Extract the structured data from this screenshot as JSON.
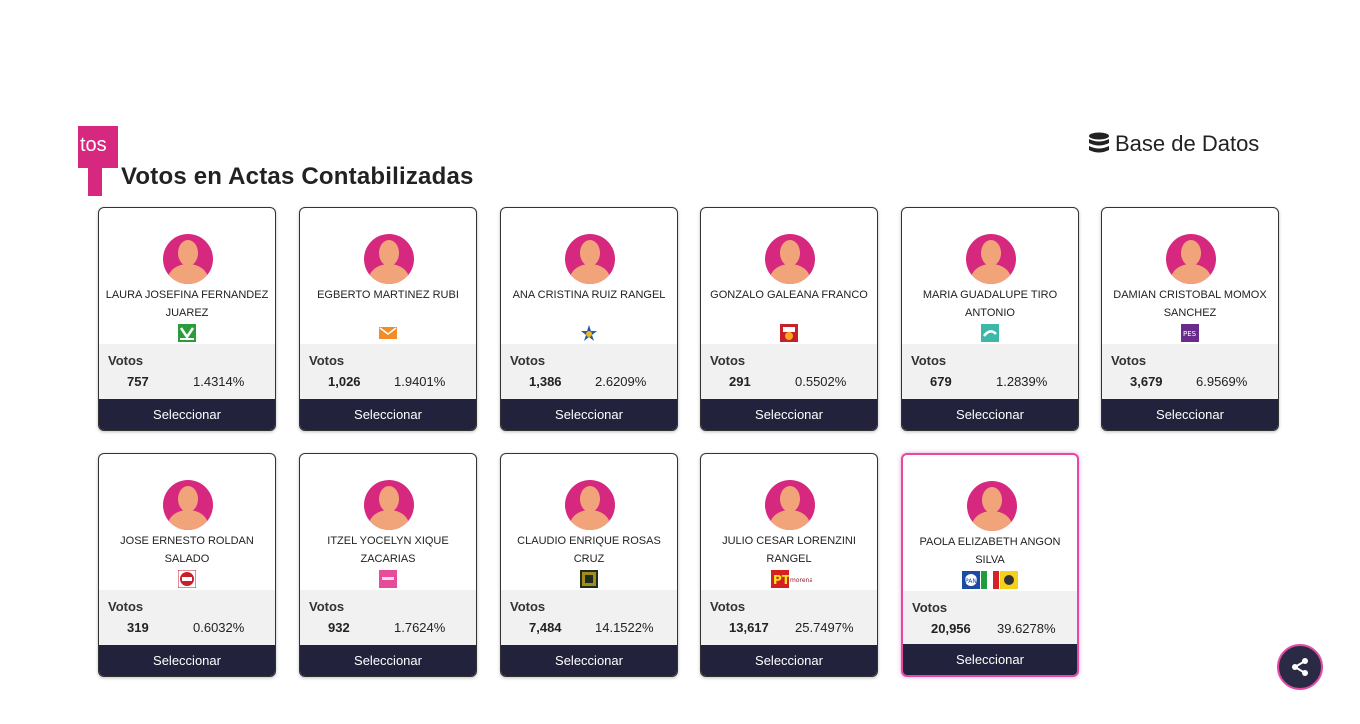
{
  "header": {
    "tab_fragment": "tos",
    "section_title": "Votos en Actas Contabilizadas",
    "database_link": "Base de Datos",
    "database_icon": "database-icon"
  },
  "colors": {
    "accent": "#d6287f",
    "button_bg": "#22223c",
    "selected_border": "#e24aa3"
  },
  "candidates": [
    {
      "name": "LAURA JOSEFINA FERNANDEZ JUAREZ",
      "party_icons": [
        "pvem-logo"
      ],
      "votes_label": "Votos",
      "votes": "757",
      "percent": "1.4314%",
      "button": "Seleccionar"
    },
    {
      "name": "EGBERTO MARTINEZ RUBI",
      "party_icons": [
        "mc-logo"
      ],
      "votes_label": "Votos",
      "votes": "1,026",
      "percent": "1.9401%",
      "button": "Seleccionar"
    },
    {
      "name": "ANA CRISTINA RUIZ RANGEL",
      "party_icons": [
        "independent-logo"
      ],
      "votes_label": "Votos",
      "votes": "1,386",
      "percent": "2.6209%",
      "button": "Seleccionar"
    },
    {
      "name": "GONZALO GALEANA FRANCO",
      "party_icons": [
        "psi-logo"
      ],
      "votes_label": "Votos",
      "votes": "291",
      "percent": "0.5502%",
      "button": "Seleccionar"
    },
    {
      "name": "MARIA GUADALUPE TIRO ANTONIO",
      "party_icons": [
        "nueva-alianza-logo"
      ],
      "votes_label": "Votos",
      "votes": "679",
      "percent": "1.2839%",
      "button": "Seleccionar"
    },
    {
      "name": "DAMIAN CRISTOBAL MOMOX SANCHEZ",
      "party_icons": [
        "pes-logo"
      ],
      "votes_label": "Votos",
      "votes": "3,679",
      "percent": "6.9569%",
      "button": "Seleccionar"
    },
    {
      "name": "JOSE ERNESTO ROLDAN SALADO",
      "party_icons": [
        "rsp-logo"
      ],
      "votes_label": "Votos",
      "votes": "319",
      "percent": "0.6032%",
      "button": "Seleccionar"
    },
    {
      "name": "ITZEL YOCELYN XIQUE ZACARIAS",
      "party_icons": [
        "fxm-logo"
      ],
      "votes_label": "Votos",
      "votes": "932",
      "percent": "1.7624%",
      "button": "Seleccionar"
    },
    {
      "name": "CLAUDIO ENRIQUE ROSAS CRUZ",
      "party_icons": [
        "pacto-social-logo"
      ],
      "votes_label": "Votos",
      "votes": "7,484",
      "percent": "14.1522%",
      "button": "Seleccionar"
    },
    {
      "name": "JULIO CESAR LORENZINI RANGEL",
      "party_icons": [
        "pt-logo",
        "morena-logo"
      ],
      "votes_label": "Votos",
      "votes": "13,617",
      "percent": "25.7497%",
      "button": "Seleccionar"
    },
    {
      "name": "PAOLA ELIZABETH ANGON SILVA",
      "party_icons": [
        "pan-logo",
        "pri-logo",
        "prd-logo"
      ],
      "votes_label": "Votos",
      "votes": "20,956",
      "percent": "39.6278%",
      "button": "Seleccionar",
      "selected": true
    }
  ],
  "share_icon": "share-icon"
}
